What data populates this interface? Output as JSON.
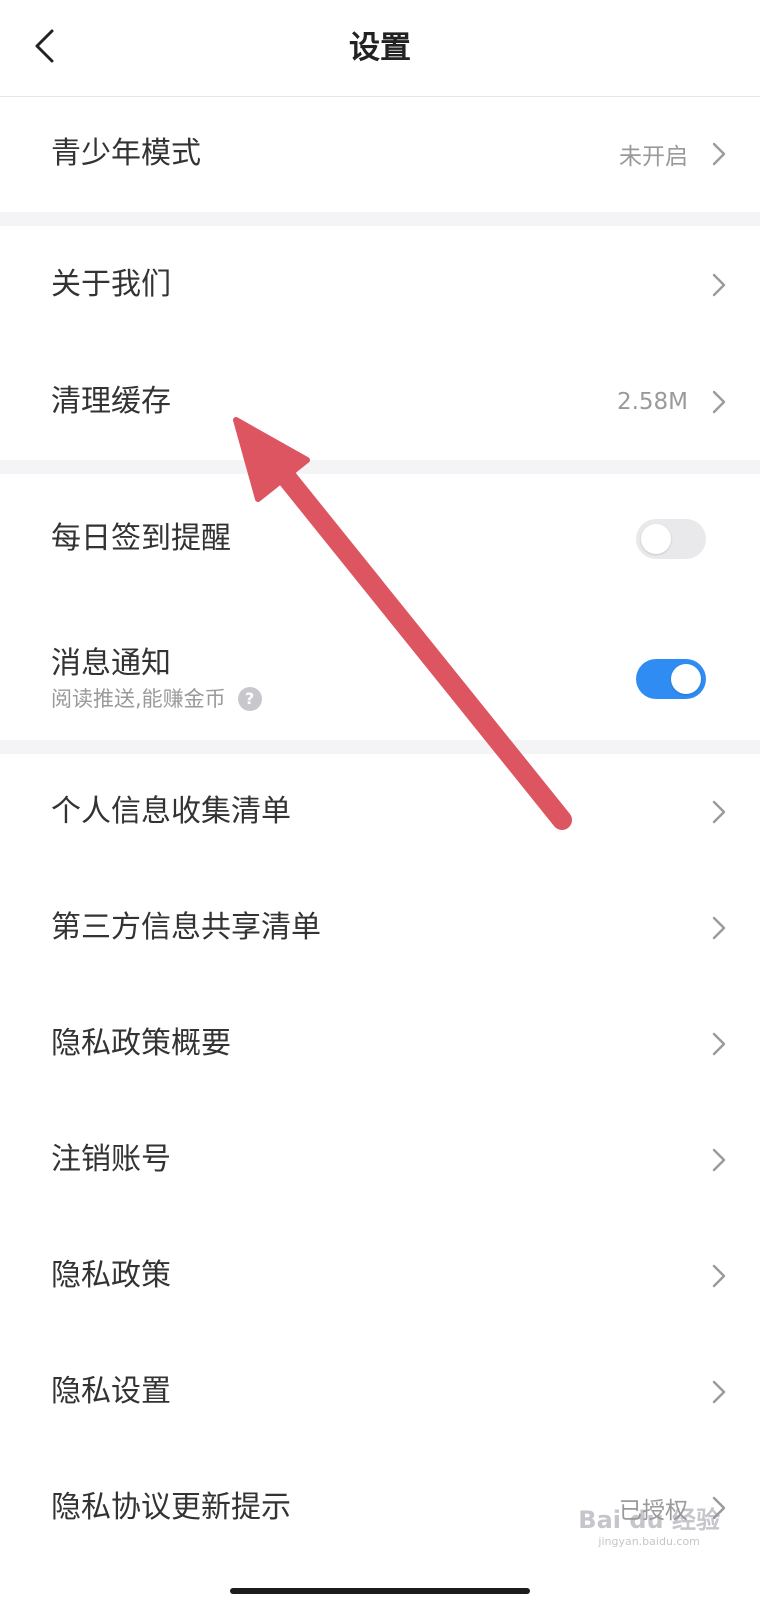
{
  "header": {
    "title": "设置",
    "back_icon": "chevron-left-icon"
  },
  "colors": {
    "accent": "#2f8cf3",
    "annotation_arrow": "#dd5560",
    "separator": "#f4f4f6"
  },
  "groups": [
    {
      "rows": [
        {
          "label": "青少年模式",
          "value": "未开启"
        }
      ]
    },
    {
      "rows": [
        {
          "label": "关于我们",
          "value": ""
        },
        {
          "label": "清理缓存",
          "value": "2.58M"
        }
      ]
    },
    {
      "rows": [
        {
          "label": "每日签到提醒",
          "toggle": false
        },
        {
          "label": "消息通知",
          "subtitle": "阅读推送,能赚金币",
          "toggle": true
        }
      ]
    },
    {
      "rows": [
        {
          "label": "个人信息收集清单"
        },
        {
          "label": "第三方信息共享清单"
        },
        {
          "label": "隐私政策概要"
        },
        {
          "label": "注销账号"
        },
        {
          "label": "隐私政策"
        },
        {
          "label": "隐私设置"
        },
        {
          "label": "隐私协议更新提示",
          "value": "已授权"
        }
      ]
    }
  ],
  "watermark": {
    "text": "Bai du 经验",
    "url": "jingyan.baidu.com"
  }
}
